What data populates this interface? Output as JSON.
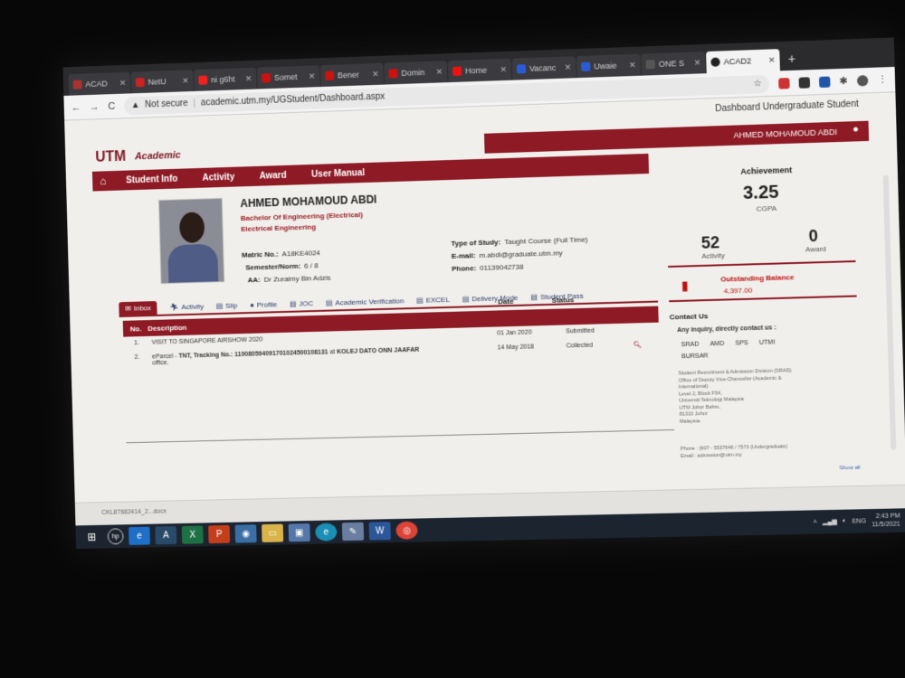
{
  "browser": {
    "tabs": [
      {
        "label": "ACAD",
        "color": "#a33"
      },
      {
        "label": "NetU",
        "color": "#c22"
      },
      {
        "label": "ni g6ht",
        "color": "#e22"
      },
      {
        "label": "Somet",
        "color": "#c11"
      },
      {
        "label": "Bener",
        "color": "#c11"
      },
      {
        "label": "Domin",
        "color": "#c11"
      },
      {
        "label": "Home",
        "color": "#e11"
      },
      {
        "label": "Vacanc",
        "color": "#2a5ad8"
      },
      {
        "label": "Uwaie",
        "color": "#2a5ad8"
      },
      {
        "label": "ONE S",
        "color": "#555"
      },
      {
        "label": "ACAD2",
        "color": "#222"
      }
    ],
    "new_tab": "+",
    "address": {
      "security": "Not secure",
      "url": "academic.utm.my/UGStudent/Dashboard.aspx"
    }
  },
  "page": {
    "header_note": "Dashboard Undergraduate Student",
    "logo": {
      "utm": "UTM",
      "academic": "Academic"
    },
    "user_name": "AHMED MOHAMOUD ABDI",
    "nav": [
      "Student Info",
      "Activity",
      "Award",
      "User Manual"
    ],
    "student": {
      "name": "AHMED MOHAMOUD ABDI",
      "program_line1": "Bachelor Of Engineering (Electrical)",
      "program_line2": "Electrical Engineering",
      "matric_label": "Matric No.:",
      "matric": "A18KE4024",
      "semester_label": "Semester/Norm:",
      "semester": "6 / 8",
      "aa_label": "AA:",
      "aa": "Dr Zuraimy Bin Adzis",
      "study_label": "Type of Study:",
      "study": "Taught Course (Full Time)",
      "email_label": "E-mail:",
      "email": "m.abdi@graduate.utm.my",
      "phone_label": "Phone:",
      "phone": "01139042738"
    },
    "tabs": [
      "Inbox",
      "Activity",
      "Slip",
      "Profile",
      "JOC",
      "Academic Verification",
      "EXCEL",
      "Delivery Mode",
      "Student Pass"
    ],
    "table": {
      "headers": {
        "no": "No.",
        "desc": "Description",
        "date": "Date",
        "status": "Status"
      },
      "rows": [
        {
          "no": "1.",
          "desc": "VISIT TO SINGAPORE AIRSHOW 2020",
          "date": "01 Jan 2020",
          "status": "Submitted"
        },
        {
          "no": "2.",
          "desc_prefix": "eParcel -",
          "desc_bold": "TNT, Tracking No.: 110080594091701024500108131",
          "desc_mid": "at",
          "desc_bold2": "KOLEJ DATO ONN JAAFAR",
          "desc_end": "office.",
          "date": "14 May 2018",
          "status": "Collected"
        }
      ]
    },
    "achievement": {
      "title": "Achievement",
      "cgpa": "3.25",
      "cgpa_label": "CGPA",
      "activity": "52",
      "activity_label": "Activity",
      "award": "0",
      "award_label": "Award"
    },
    "balance": {
      "title": "Outstanding Balance",
      "value": "4,397.00"
    },
    "contact": {
      "title": "Contact Us",
      "intro": "Any inquiry, directly contact us :",
      "units": [
        "SRAD",
        "AMD",
        "SPS",
        "UTMI",
        "BURSAR"
      ],
      "lines": [
        "Student Recruitment & Admission Division (SRAD)",
        "Office of Deputy Vice-Chancellor (Academic &",
        "International)",
        "Level 2, Block F54,",
        "Universiti Teknologi Malaysia",
        "UTM Johor Bahru,",
        "81310 Johor",
        "Malaysia."
      ],
      "phone_line": "Phone : (607 - 5537646 / 7573 (Undergraduate)",
      "email_line": "Email : admission@utm.my",
      "show_all": "Show all"
    },
    "download": "CKL87682414_2...docx"
  },
  "taskbar": {
    "clock_time": "2:43 PM",
    "clock_date": "11/5/2021",
    "lang": "ENG"
  }
}
